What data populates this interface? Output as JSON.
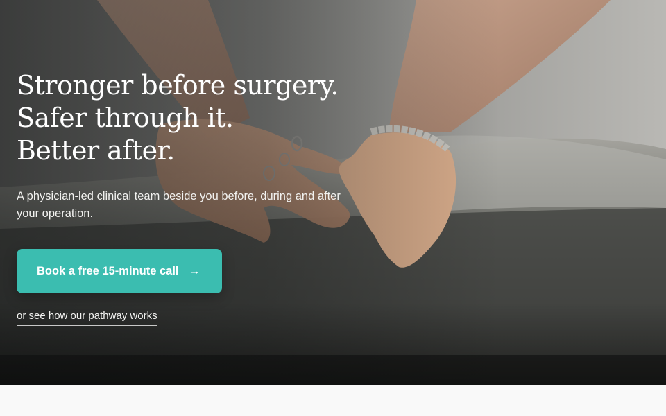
{
  "hero": {
    "headline_lines": [
      "Stronger before surgery.",
      "Safer through it.",
      "Better after."
    ],
    "subtext": "A physician-led clinical team beside you before, during and after your operation.",
    "cta_label": "Book a free 15-minute call",
    "cta_arrow": "→",
    "secondary_link": "or see how our pathway works"
  },
  "colors": {
    "accent": "#3bbdb0",
    "text_on_hero": "#ffffff",
    "page_background": "#f9f9f9"
  }
}
